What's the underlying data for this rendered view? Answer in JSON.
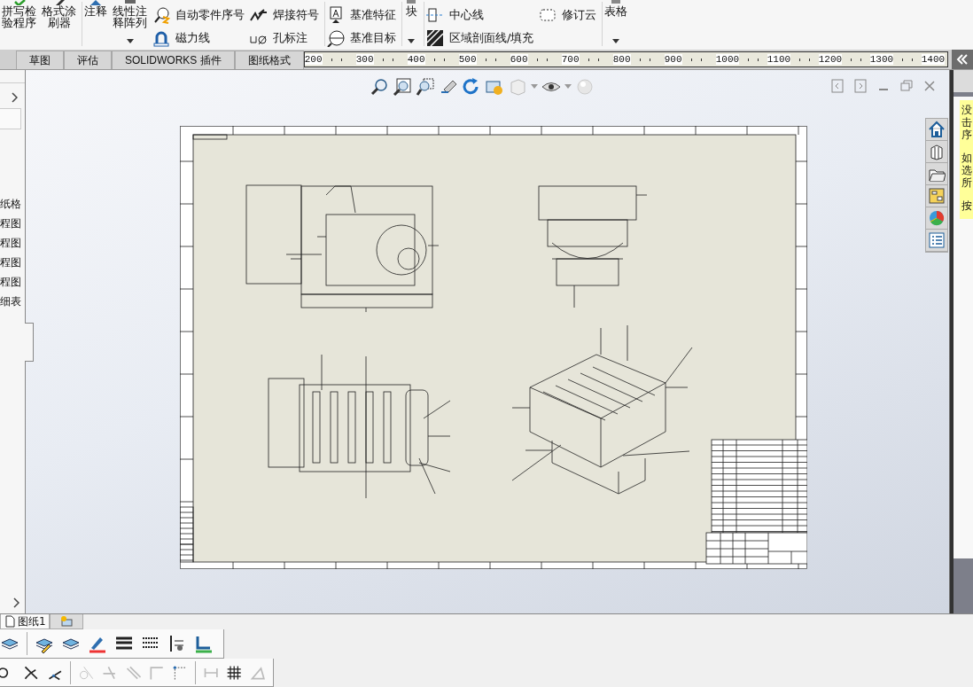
{
  "ribbon_groups": [
    {
      "items": [
        {
          "kind": "large",
          "lines": [
            "拼写检",
            "验程序"
          ]
        },
        {
          "kind": "large",
          "lines": [
            "格式涂",
            "刷器"
          ]
        }
      ]
    },
    {
      "items": [
        {
          "kind": "large",
          "lines": [
            "注释"
          ]
        },
        {
          "kind": "large",
          "lines": [
            "线性注",
            "释阵列"
          ],
          "dropdown": true
        },
        {
          "kind": "column",
          "entries": [
            "自动零件序号",
            "磁力线"
          ]
        },
        {
          "kind": "column",
          "entries": [
            "焊接符号",
            "孔标注"
          ]
        }
      ]
    },
    {
      "items": [
        {
          "kind": "column",
          "entries": [
            "基准特征",
            "基准目标"
          ]
        }
      ]
    },
    {
      "items": [
        {
          "kind": "large",
          "lines": [
            "块"
          ],
          "dropdown": true
        }
      ]
    },
    {
      "items": [
        {
          "kind": "column",
          "entries": [
            "中心线",
            "区域剖面线/填充"
          ]
        },
        {
          "kind": "column",
          "entries": [
            "修订云"
          ]
        }
      ]
    },
    {
      "items": [
        {
          "kind": "large",
          "lines": [
            "表格"
          ],
          "dropdown": true
        }
      ]
    }
  ],
  "tabs": [
    {
      "label": "草图",
      "selected": false
    },
    {
      "label": "评估",
      "selected": false
    },
    {
      "label": "SOLIDWORKS 插件",
      "selected": false
    },
    {
      "label": "图纸格式",
      "selected": false
    }
  ],
  "ruler_labels": [
    "200",
    "300",
    "400",
    "500",
    "600",
    "700",
    "800",
    "900",
    "1000",
    "1100",
    "1200",
    "1300",
    "1400"
  ],
  "tree_items": [
    "纸格",
    "程图",
    "程图",
    "程图",
    "程图",
    "细表"
  ],
  "task_pane_tip": [
    [
      "没",
      "击",
      "序"
    ],
    [
      "如",
      "选",
      "所"
    ],
    [
      "按"
    ]
  ],
  "sheet_tabs": [
    {
      "label": "图纸1",
      "selected": true
    },
    {
      "selected": false
    }
  ]
}
